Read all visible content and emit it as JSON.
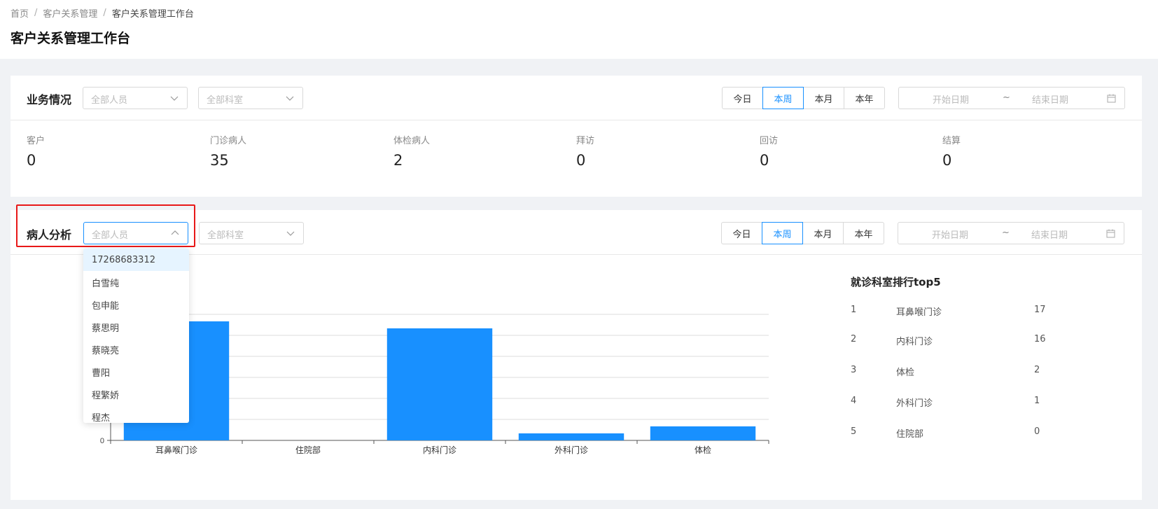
{
  "breadcrumb": [
    "首页",
    "客户关系管理",
    "客户关系管理工作台"
  ],
  "page_title": "客户关系管理工作台",
  "business": {
    "title": "业务情况",
    "person_placeholder": "全部人员",
    "dept_placeholder": "全部科室",
    "periods": [
      "今日",
      "本周",
      "本月",
      "本年"
    ],
    "selected_period": "本周",
    "start_placeholder": "开始日期",
    "tilde": "~",
    "end_placeholder": "结束日期",
    "stats": [
      {
        "label": "客户",
        "value": "0"
      },
      {
        "label": "门诊病人",
        "value": "35"
      },
      {
        "label": "体检病人",
        "value": "2"
      },
      {
        "label": "拜访",
        "value": "0"
      },
      {
        "label": "回访",
        "value": "0"
      },
      {
        "label": "结算",
        "value": "0"
      }
    ]
  },
  "analysis": {
    "title": "病人分析",
    "person_placeholder": "全部人员",
    "dept_placeholder": "全部科室",
    "periods": [
      "今日",
      "本周",
      "本月",
      "本年"
    ],
    "selected_period": "本周",
    "start_placeholder": "开始日期",
    "tilde": "~",
    "end_placeholder": "结束日期",
    "dropdown_options": [
      "17268683312",
      "白雪纯",
      "包申能",
      "蔡思明",
      "蔡晓亮",
      "曹阳",
      "程繁娇",
      "程杰"
    ],
    "ranking": {
      "title": "就诊科室排行top5",
      "rows": [
        {
          "rank": "1",
          "name": "耳鼻喉门诊",
          "count": "17"
        },
        {
          "rank": "2",
          "name": "内科门诊",
          "count": "16"
        },
        {
          "rank": "3",
          "name": "体检",
          "count": "2"
        },
        {
          "rank": "4",
          "name": "外科门诊",
          "count": "1"
        },
        {
          "rank": "5",
          "name": "住院部",
          "count": "0"
        }
      ]
    }
  },
  "colors": {
    "accent": "#1890ff",
    "bar": "#1890ff",
    "highlight": "#e81818"
  },
  "chart_data": {
    "type": "bar",
    "categories": [
      "耳鼻喉门诊",
      "住院部",
      "内科门诊",
      "外科门诊",
      "体检"
    ],
    "values": [
      17,
      0,
      16,
      1,
      2
    ],
    "ytick_labels": [
      "0"
    ],
    "ylim": [
      0,
      18
    ]
  }
}
